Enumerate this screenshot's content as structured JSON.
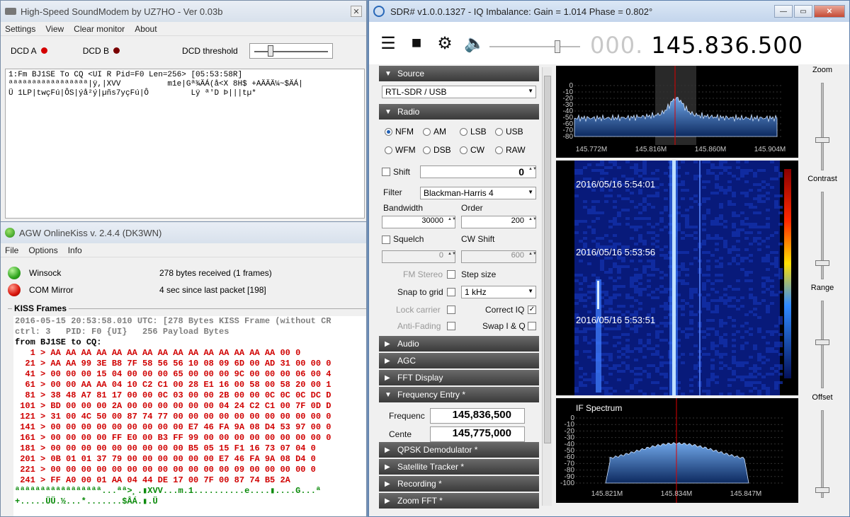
{
  "soundmodem": {
    "title": "High-Speed SoundModem by UZ7HO - Ver 0.03b",
    "menu": [
      "Settings",
      "View",
      "Clear monitor",
      "About"
    ],
    "dcd_a": "DCD A",
    "dcd_b": "DCD B",
    "dcd_threshold": "DCD threshold",
    "monitor_lines": [
      "1:Fm BJ1SE To CQ <UI R Pid=F0 Len=256> [05:53:58R]",
      "ªªªªªªªªªªªªªªªªª|ÿ,|XVV          m1e|Gª¾ÄÁ(å<X 8H$ +AÄÄÄ¼~$ÄÁ|",
      "Ü 1LP|twçFú|ÔS|ýå²ý|µñs7yçFú|Ô         Lÿ ª'D Þ|||tµ*"
    ]
  },
  "kiss": {
    "title": "AGW OnlineKiss v. 2.4.4  (DK3WN)",
    "menu": [
      "File",
      "Options",
      "Info"
    ],
    "winsock_label": "Winsock",
    "winsock_status": "278 bytes received (1 frames)",
    "com_label": "COM Mirror",
    "com_status": "4 sec since last packet [198]",
    "frames_label": "KISS Frames",
    "header_lines": [
      "2016-05-15 20:53:58.010 UTC: [278 Bytes KISS Frame (without CR",
      "ctrl: 3   PID: F0 {UI}   256 Payload Bytes"
    ],
    "from_line": "from BJ1SE to CQ:",
    "hex_lines": [
      "   1 > AA AA AA AA AA AA AA AA AA AA AA AA AA AA AA 00 0",
      "  21 > AA AA 99 3E B8 7F 58 56 56 10 08 09 6D 00 AD 31 00 00 0",
      "  41 > 00 00 00 15 04 00 00 00 65 00 00 00 9C 00 00 00 06 00 4",
      "  61 > 00 00 AA AA 04 10 C2 C1 00 28 E1 16 00 58 00 58 20 00 1",
      "  81 > 38 48 A7 81 17 00 00 0C 03 00 00 2B 00 00 0C 0C 0C DC D",
      " 101 > BD 00 00 00 2A 00 00 00 00 00 00 04 24 C2 C1 00 7F 0D D",
      " 121 > 31 00 4C 50 00 87 74 77 00 00 00 00 00 00 00 00 00 00 0",
      " 141 > 00 00 00 00 00 00 00 00 00 E7 46 FA 9A 08 D4 53 97 00 0",
      " 161 > 00 00 00 00 FF E0 00 B3 FF 99 00 00 00 00 00 00 00 00 0",
      " 181 > 00 00 00 00 00 00 00 00 00 B5 05 15 F1 16 73 07 04 0",
      " 201 > 0B 01 01 37 79 00 00 00 00 00 00 E7 46 FA 9A 08 D4 0",
      " 221 > 00 00 00 00 00 00 00 00 00 00 00 00 09 00 00 00 00 0",
      " 241 > FF A0 00 01 AA 04 44 DE 17 00 7F 00 87 74 B5 2A"
    ],
    "ascii_lines": [
      "ªªªªªªªªªªªªªªªªª...ªª>¸.▮XVV...m.1..........e....▮....G...ª",
      "+.....ÜÜ.½...*.......$ÂÁ.▮.Ü"
    ]
  },
  "sdr": {
    "title": "SDR# v1.0.0.1327 - IQ Imbalance: Gain = 1.014 Phase = 0.802°",
    "freq_dim": "000.",
    "freq_main": "145.836.500",
    "sections": {
      "source": "Source",
      "radio": "Radio",
      "audio": "Audio",
      "agc": "AGC",
      "fft": "FFT Display",
      "freq_entry": "Frequency Entry *",
      "qpsk": "QPSK Demodulator *",
      "sat": "Satellite Tracker *",
      "rec": "Recording *",
      "zoom": "Zoom FFT *"
    },
    "source_value": "RTL-SDR / USB",
    "modes": [
      "NFM",
      "AM",
      "LSB",
      "USB",
      "WFM",
      "DSB",
      "CW",
      "RAW"
    ],
    "selected_mode": "NFM",
    "shift_label": "Shift",
    "shift_value": "0",
    "filter_label": "Filter",
    "filter_value": "Blackman-Harris 4",
    "bandwidth_label": "Bandwidth",
    "bandwidth_value": "30000",
    "order_label": "Order",
    "order_value": "200",
    "squelch_label": "Squelch",
    "squelch_value": "0",
    "cwshift_label": "CW Shift",
    "cwshift_value": "600",
    "fmstereo_label": "FM Stereo",
    "stepsize_label": "Step size",
    "snap_label": "Snap to grid",
    "step_value": "1 kHz",
    "lock_label": "Lock carrier",
    "correctiq_label": "Correct IQ",
    "antifading_label": "Anti-Fading",
    "swapiq_label": "Swap I & Q",
    "frequenc_label": "Frequenc",
    "frequenc_value": "145,836,500",
    "center_label": "Cente",
    "center_value": "145,775,000",
    "spectrum_ticks_y": [
      "0",
      "-10",
      "-20",
      "-30",
      "-40",
      "-50",
      "-60",
      "-70",
      "-80"
    ],
    "spectrum_ticks_x": [
      "145.772M",
      "145.816M",
      "145.860M",
      "145.904M"
    ],
    "waterfall_times": [
      "2016/05/16 5:54:01",
      "2016/05/16 5:53:56",
      "2016/05/16 5:53:51"
    ],
    "if_title": "IF Spectrum",
    "if_ticks_y": [
      "0",
      "-10",
      "-20",
      "-30",
      "-40",
      "-50",
      "-60",
      "-70",
      "-80",
      "-90",
      "-100"
    ],
    "if_ticks_x": [
      "145.821M",
      "145.834M",
      "145.847M"
    ],
    "zoom_label": "Zoom",
    "contrast_label": "Contrast",
    "range_label": "Range",
    "offset_label": "Offset"
  }
}
